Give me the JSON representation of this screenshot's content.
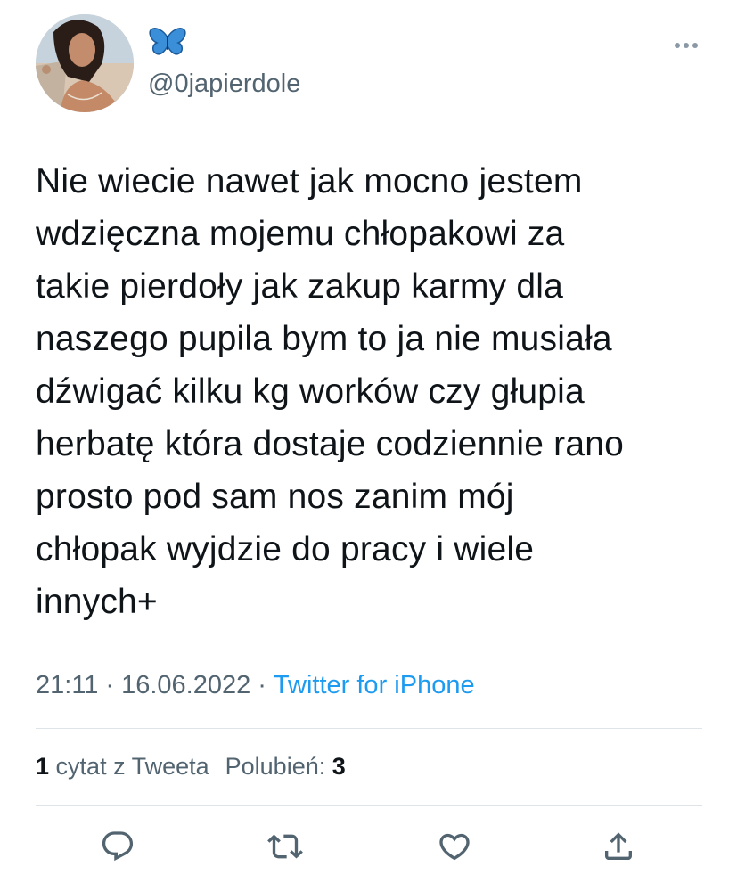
{
  "user": {
    "display_name_icon": "butterfly-emoji",
    "handle": "@0japierdole"
  },
  "tweet": {
    "text": "Nie wiecie nawet jak mocno jestem\nwdzięczna mojemu chłopakowi za\ntakie pierdoły jak zakup karmy dla\nnaszego pupila bym to ja nie musiała\ndźwigać kilku kg worków czy głupia\nherbatę która dostaje codziennie rano\nprosto pod sam nos zanim mój\nchłopak wyjdzie do pracy i wiele\ninnych+"
  },
  "meta": {
    "time": "21:11",
    "separator": "·",
    "date": "16.06.2022",
    "source": "Twitter for iPhone"
  },
  "stats": {
    "quotes_count": "1",
    "quotes_label": "cytat z Tweeta",
    "likes_label": "Polubień:",
    "likes_count": "3"
  },
  "actions": {
    "reply_icon": "reply-icon",
    "retweet_icon": "retweet-icon",
    "like_icon": "like-icon",
    "share_icon": "share-icon"
  },
  "colors": {
    "accent": "#1d9bf0",
    "butterfly": "#3a8fd8",
    "secondary_text": "#536471",
    "icon": "#536471"
  }
}
